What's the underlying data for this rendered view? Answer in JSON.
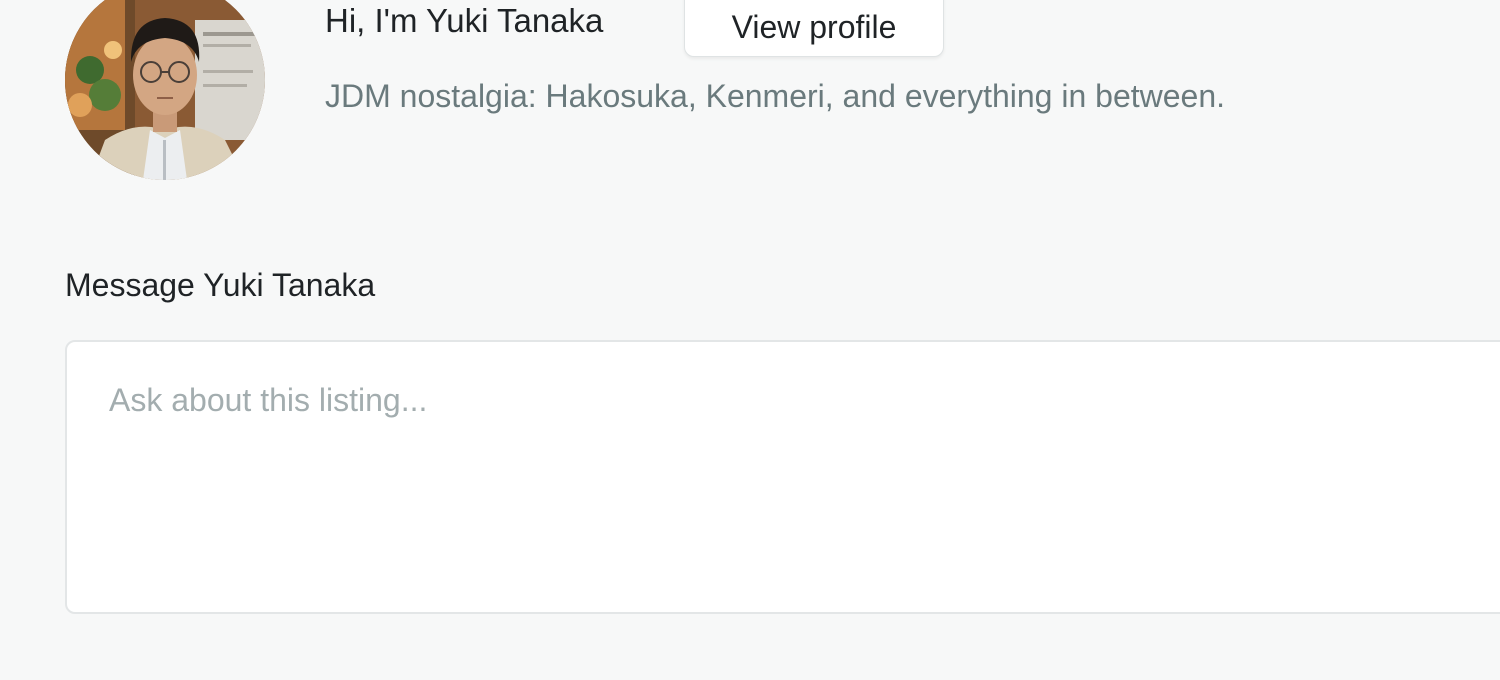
{
  "host": {
    "greeting": "Hi, I'm Yuki Tanaka",
    "tagline": "JDM nostalgia: Hakosuka, Kenmeri, and everything in between.",
    "view_profile_label": "View profile"
  },
  "message": {
    "label": "Message Yuki Tanaka",
    "placeholder": "Ask about this listing..."
  },
  "colors": {
    "background": "#f7f8f8",
    "text_primary": "#1f2326",
    "text_secondary": "#6a7a7d",
    "placeholder": "#a3adaf"
  },
  "icons": {
    "avatar": "host-avatar-photo"
  }
}
